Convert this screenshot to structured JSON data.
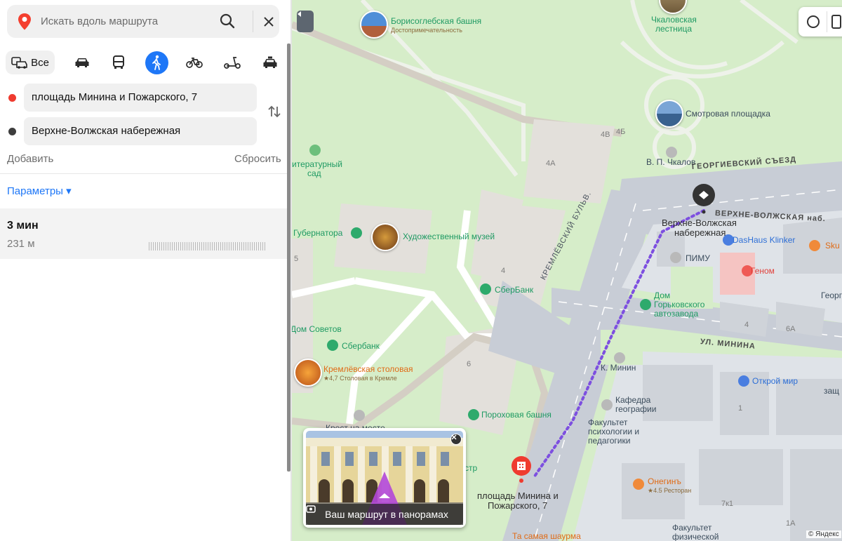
{
  "search": {
    "placeholder": "Искать вдоль маршрута"
  },
  "modes": {
    "all_label": "Все",
    "items": [
      "car-icon",
      "bus-icon",
      "walk-icon",
      "bike-icon",
      "scooter-icon",
      "taxi-icon"
    ],
    "selected": "walk-icon"
  },
  "route": {
    "from": "площадь Минина и Пожарского, 7",
    "to": "Верхне-Волжская набережная",
    "add_label": "Добавить",
    "reset_label": "Сбросить",
    "params_label": "Параметры ▾"
  },
  "result": {
    "time": "3 мин",
    "distance": "231 м"
  },
  "colors": {
    "accent": "#1e77f7",
    "start_dot": "#ef3b2f",
    "end_dot": "#3d3d3d",
    "route": "#7d4fe0"
  },
  "map": {
    "labels": {
      "borisoglebsk": "Борисоглебская башня",
      "borisoglebsk_sub": "Достопримечательность",
      "chkalov_stairs_1": "Чкаловская",
      "chkalov_stairs_2": "лестница",
      "viewpoint": "Смотровая площадка",
      "chkalov": "В. П. Чкалов",
      "lit_garden_1": "итературный",
      "lit_garden_2": "сад",
      "governor": "Губернатора",
      "art_museum": "Художественный музей",
      "sberbank1": "СберБанк",
      "sberbank2": "Сбербанк",
      "dom_sovetov": "Дом Советов",
      "kremlin_canteen": "Кремлёвская столовая",
      "kremlin_canteen_sub": "★4,7 Столовая в Кремле",
      "powder_tower": "Пороховая башня",
      "krest": "Крест на месте",
      "georgievsky": "ГЕОРГИЕВСКИЙ СЪЕЗД",
      "vv_nab_street": "ВЕРХНЕ-ВОЛЖСКАЯ наб.",
      "destination_1": "Верхне-Волжская",
      "destination_2": "набережная",
      "dashaus": "DasHaus Klinker",
      "sku": "Sku",
      "pimu": "ПИМУ",
      "genom": "Геном",
      "dom_gaz_1": "Дом",
      "dom_gaz_2": "Горьковского",
      "dom_gaz_3": "автозавода",
      "minina_st": "УЛ. МИНИНА",
      "k_minin": "К. Минин",
      "otkroy": "Открой мир",
      "geo_1": "Кафедра",
      "geo_2": "географии",
      "psy_1": "Факультет",
      "psy_2": "психологии и",
      "psy_3": "педагогики",
      "onegin": "Онегинъ",
      "onegin_sub": "★4.5 Ресторан",
      "start_1": "площадь Минина и",
      "start_2": "Пожарского, 7",
      "shaurma": "Та самая шаурма",
      "fak_phys": "Факультет",
      "fak_phys2": "физической",
      "kremlin_blvd": "КРЕМЛЁВСКИЙ БУЛЬВ.",
      "geor_partial": "Георг",
      "zash": "защ",
      "str": "стр",
      "n4a": "4А",
      "n4b": "4Б",
      "n4v": "4В",
      "n4": "4",
      "n5": "5",
      "n6": "6",
      "n6a": "6А",
      "n1": "1",
      "n1a": "1А",
      "n7k1": "7к1",
      "n4b2": "4"
    },
    "panorama_caption": "Ваш маршрут в панорамах",
    "copyright": "© Яндекс"
  }
}
